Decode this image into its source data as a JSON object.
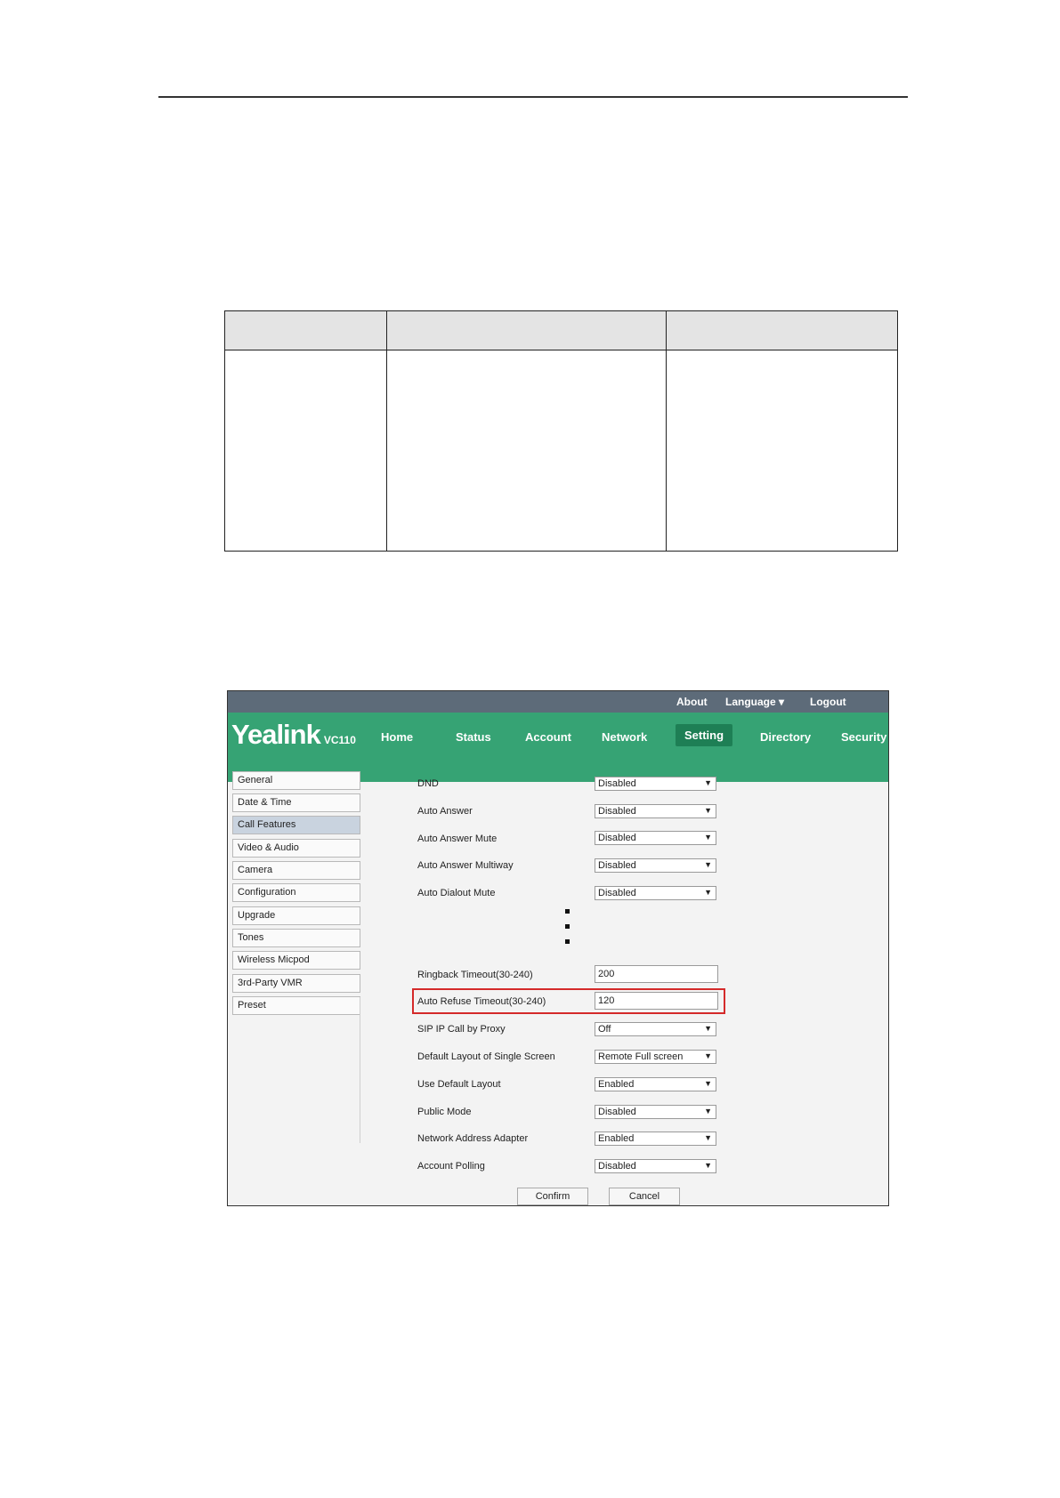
{
  "top_links": {
    "about": "About",
    "language": "Language ▾",
    "logout": "Logout"
  },
  "brand": {
    "logo": "Yealink",
    "model": "VC110"
  },
  "nav": {
    "home": "Home",
    "status": "Status",
    "account": "Account",
    "network": "Network",
    "setting": "Setting",
    "directory": "Directory",
    "security": "Security"
  },
  "sidebar": {
    "items": [
      {
        "label": "General"
      },
      {
        "label": "Date & Time"
      },
      {
        "label": "Call Features"
      },
      {
        "label": "Video & Audio"
      },
      {
        "label": "Camera"
      },
      {
        "label": "Configuration"
      },
      {
        "label": "Upgrade"
      },
      {
        "label": "Tones"
      },
      {
        "label": "Wireless Micpod"
      },
      {
        "label": "3rd-Party VMR"
      },
      {
        "label": "Preset"
      }
    ],
    "active": "Call Features"
  },
  "form": {
    "dnd": {
      "label": "DND",
      "value": "Disabled"
    },
    "auto_answer": {
      "label": "Auto Answer",
      "value": "Disabled"
    },
    "auto_answer_mute": {
      "label": "Auto Answer Mute",
      "value": "Disabled"
    },
    "auto_answer_multiway": {
      "label": "Auto Answer Multiway",
      "value": "Disabled"
    },
    "auto_dialout_mute": {
      "label": "Auto Dialout Mute",
      "value": "Disabled"
    },
    "ringback_timeout": {
      "label": "Ringback Timeout(30-240)",
      "value": "200"
    },
    "auto_refuse_timeout": {
      "label": "Auto Refuse Timeout(30-240)",
      "value": "120"
    },
    "sip_ip_call_by_proxy": {
      "label": "SIP IP Call by Proxy",
      "value": "Off"
    },
    "default_layout_single": {
      "label": "Default Layout of Single Screen",
      "value": "Remote Full screen"
    },
    "use_default_layout": {
      "label": "Use Default Layout",
      "value": "Enabled"
    },
    "public_mode": {
      "label": "Public Mode",
      "value": "Disabled"
    },
    "network_address_adapter": {
      "label": "Network Address Adapter",
      "value": "Enabled"
    },
    "account_polling": {
      "label": "Account Polling",
      "value": "Disabled"
    }
  },
  "buttons": {
    "confirm": "Confirm",
    "cancel": "Cancel"
  },
  "colors": {
    "nav_green": "#36a374",
    "active_tab": "#1e7f55",
    "topbar": "#5d6b79",
    "highlight": "#d42a2a"
  }
}
